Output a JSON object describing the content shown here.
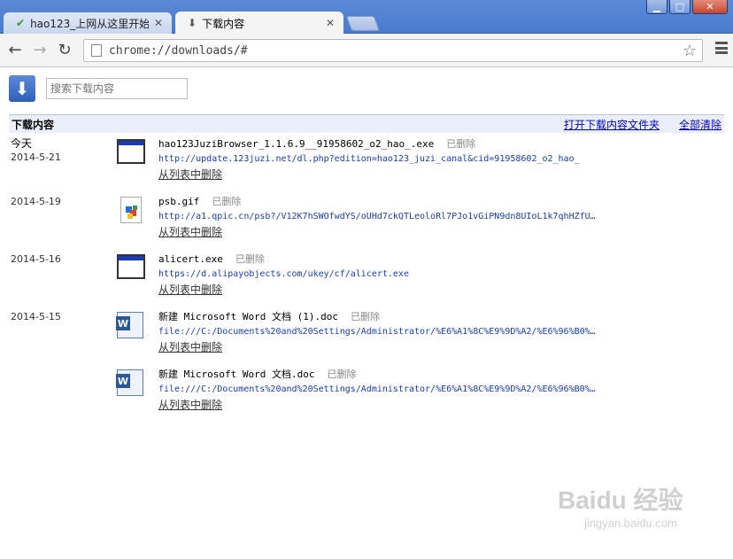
{
  "tabs": [
    {
      "label": "hao123_上网从这里开始",
      "icon": "hao123-icon",
      "active": false
    },
    {
      "label": "下载内容",
      "icon": "download-arrow-icon",
      "active": true
    }
  ],
  "window": {
    "minimize": "▁",
    "maximize": "□",
    "close": "✕"
  },
  "toolbar": {
    "back": "←",
    "forward": "→",
    "reload": "↻",
    "url": "chrome://downloads/#",
    "star": "☆"
  },
  "page": {
    "search_placeholder": "搜索下载内容",
    "section_title": "下载内容",
    "open_folder_link": "打开下载内容文件夹",
    "clear_all_link": "全部清除"
  },
  "downloads": [
    {
      "day": "今天",
      "date": "2014-5-21",
      "name": "hao123JuziBrowser_1.1.6.9__91958602_o2_hao_.exe",
      "status": "已删除",
      "url": "http://update.123juzi.net/dl.php?edition=hao123_juzi_canal&cid=91958602_o2_hao_",
      "remove": "从列表中删除",
      "icon": "exe"
    },
    {
      "day": "",
      "date": "2014-5-19",
      "name": "psb.gif",
      "status": "已删除",
      "url": "http://a1.qpic.cn/psb?/V12K7hSWOfwdYS/oUHd7ckQTLeoloRl7PJo1vGiPN9dn8UIoL1k7qhHZfU…",
      "remove": "从列表中删除",
      "icon": "gif"
    },
    {
      "day": "",
      "date": "2014-5-16",
      "name": "alicert.exe",
      "status": "已删除",
      "url": "https://d.alipayobjects.com/ukey/cf/alicert.exe",
      "remove": "从列表中删除",
      "icon": "exe"
    },
    {
      "day": "",
      "date": "2014-5-15",
      "name": "新建 Microsoft Word 文档 (1).doc",
      "status": "已删除",
      "url": "file:///C:/Documents%20and%20Settings/Administrator/%E6%A1%8C%E9%9D%A2/%E6%96%B0%…",
      "remove": "从列表中删除",
      "icon": "doc"
    },
    {
      "day": "",
      "date": "",
      "name": "新建 Microsoft Word 文档.doc",
      "status": "已删除",
      "url": "file:///C:/Documents%20and%20Settings/Administrator/%E6%A1%8C%E9%9D%A2/%E6%96%B0%…",
      "remove": "从列表中删除",
      "icon": "doc"
    }
  ],
  "watermark": {
    "brand": "Baidu 经验",
    "site": "jingyan.baidu.com"
  }
}
